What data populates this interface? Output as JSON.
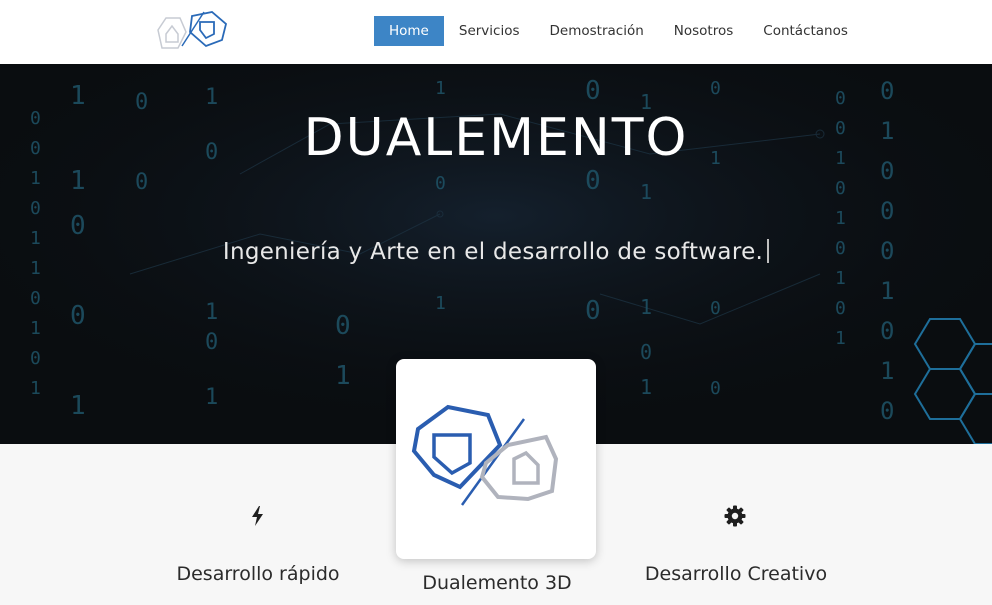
{
  "brand": {
    "logo_icon": "dualemento-logo-icon"
  },
  "nav": {
    "items": [
      {
        "label": "Home",
        "active": true
      },
      {
        "label": "Servicios",
        "active": false
      },
      {
        "label": "Demostración",
        "active": false
      },
      {
        "label": "Nosotros",
        "active": false
      },
      {
        "label": "Contáctanos",
        "active": false
      }
    ]
  },
  "hero": {
    "title": "DUALEMENTO",
    "subtitle": "Ingeniería y Arte en el desarrollo de software."
  },
  "features": [
    {
      "icon": "lightning-bolt-icon",
      "title": "Desarrollo rápido"
    },
    {
      "icon": "dualemento-3d-logo-icon",
      "title": "Dualemento 3D"
    },
    {
      "icon": "gear-icon",
      "title": "Desarrollo Creativo"
    }
  ],
  "colors": {
    "accent": "#3d85c6",
    "hero_bg": "#0a0d10",
    "logo_blue": "#2a5db0",
    "logo_gray": "#b0b3bd"
  }
}
